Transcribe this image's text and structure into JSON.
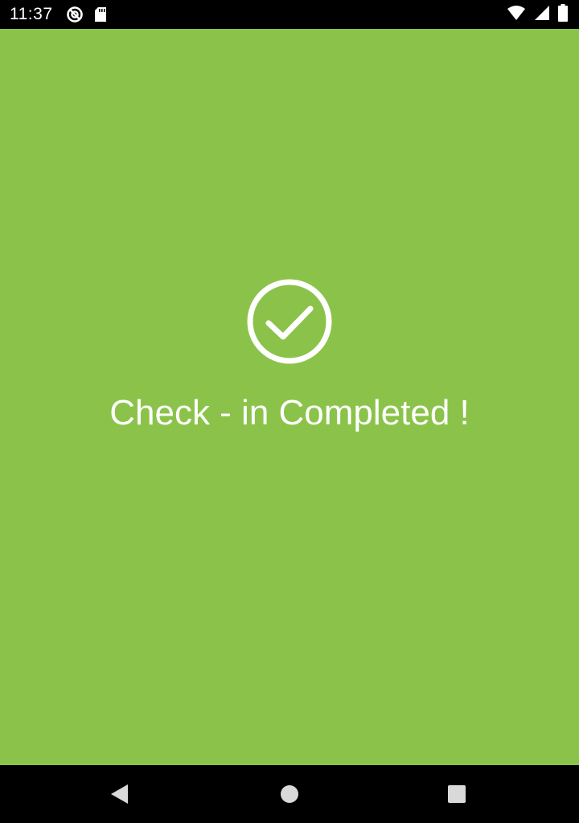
{
  "status_bar": {
    "time": "11:37",
    "icons": [
      "vpn-blocked-icon",
      "sd-card-icon",
      "wifi-icon",
      "signal-icon",
      "battery-icon"
    ]
  },
  "main": {
    "message": "Check - in Completed !",
    "icon": "check-circle-icon",
    "background_color": "#8bc34a",
    "foreground_color": "#ffffff"
  },
  "nav_bar": {
    "buttons": [
      "back",
      "home",
      "recents"
    ]
  }
}
